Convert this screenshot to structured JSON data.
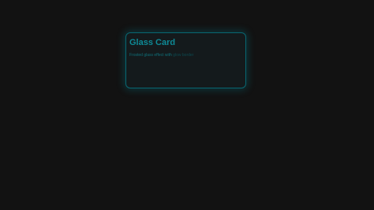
{
  "page": {
    "background_color": "#121212"
  },
  "card": {
    "title": "Glass Card",
    "text_main": "Frosted glass effect with",
    "text_muted": "glow border",
    "accent_color": "#0e8a96"
  }
}
